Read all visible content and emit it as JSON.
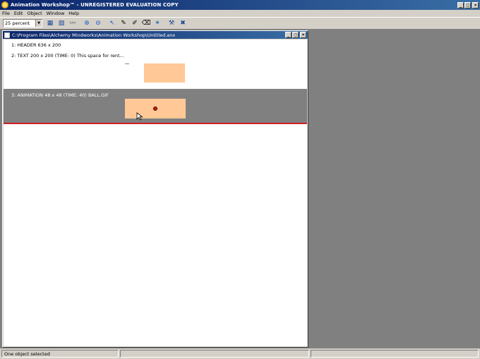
{
  "app": {
    "title": "Animation Workshop™ - UNREGISTERED EVALUATION COPY",
    "window_buttons": [
      "_",
      "□",
      "×"
    ]
  },
  "menu": [
    "File",
    "Edit",
    "Object",
    "Window",
    "Help"
  ],
  "toolbar": {
    "zoom_value": "25 percent",
    "buttons": [
      {
        "icon": "image-icon",
        "glyph": "▦"
      },
      {
        "icon": "image-copy-icon",
        "glyph": "▧"
      },
      {
        "icon": "binoculars-icon",
        "glyph": "👓"
      },
      {
        "icon": "zoom-in-icon",
        "glyph": "⊕"
      },
      {
        "icon": "zoom-out-icon",
        "glyph": "⊖"
      },
      {
        "icon": "pointer-icon",
        "glyph": "↖"
      },
      {
        "icon": "pencil-icon",
        "glyph": "✎"
      },
      {
        "icon": "brush-icon",
        "glyph": "✐"
      },
      {
        "icon": "eraser-icon",
        "glyph": "⌫"
      },
      {
        "icon": "wizard-icon",
        "glyph": "✶"
      },
      {
        "icon": "tools-icon",
        "glyph": "⚒"
      },
      {
        "icon": "delete-icon",
        "glyph": "✖"
      }
    ]
  },
  "document": {
    "path": "C:\\Program Files\\Alchemy Mindworks\\Animation Workshop\\Untitled.anx",
    "layers": [
      {
        "label": "1: HEADER 636 x 200"
      },
      {
        "label": "2: TEXT 200 x 200 (TIME: 0)  This space for rent..."
      },
      {
        "label": "3: ANIMATION 48 x 48 (TIME: 40)  BALL.GIF"
      }
    ]
  },
  "status": {
    "message": "One object selected",
    "panes": [
      "",
      ""
    ]
  },
  "colors": {
    "title_active": "#0a246a",
    "swatch": "#ffc896",
    "selected_layer": "#808080",
    "selection_line": "#d02020"
  }
}
